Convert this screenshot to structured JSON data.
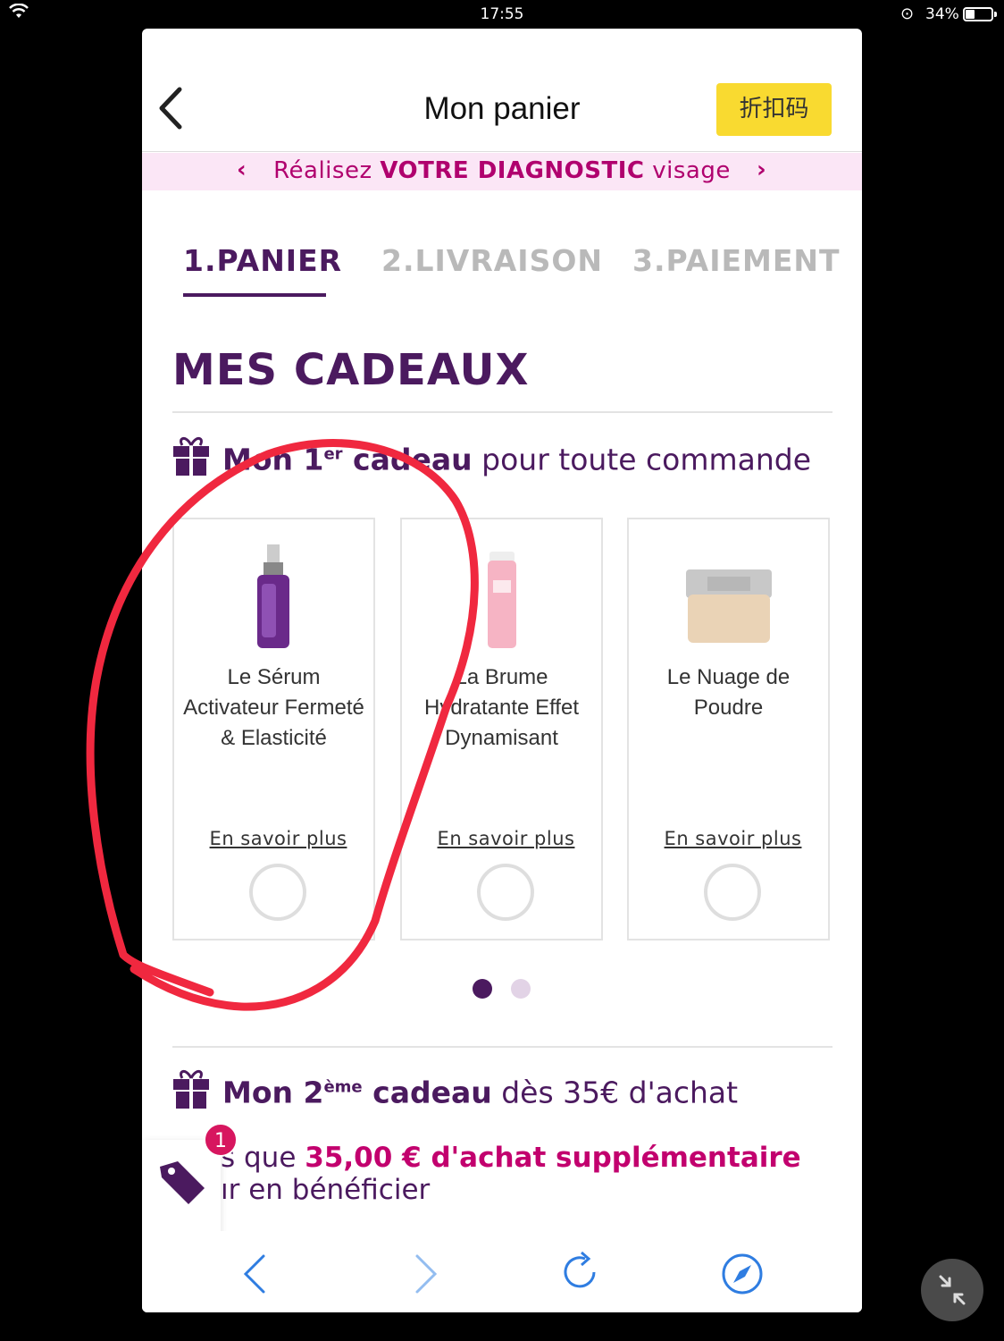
{
  "status_bar": {
    "time": "17:55",
    "battery": "34%",
    "battery_level": 0.34
  },
  "header": {
    "title": "Mon panier",
    "promo_button": "折扣码"
  },
  "diagnostic_banner": {
    "pre": "Réalisez ",
    "bold": "VOTRE DIAGNOSTIC",
    "post": " visage"
  },
  "steps": [
    {
      "label": "1.PANIER",
      "active": true
    },
    {
      "label": "2.LIVRAISON",
      "active": false
    },
    {
      "label": "3.PAIEMENT",
      "active": false
    }
  ],
  "section_title": "MES CADEAUX",
  "gift1": {
    "prefix": "Mon 1",
    "sup": "er",
    "bold_tail": " cadeau",
    "rest": " pour toute commande"
  },
  "products": [
    {
      "name": "Le Sérum Activateur Fermeté & Elasticité",
      "more": "En savoir plus",
      "selected": false
    },
    {
      "name": "La Brume Hydratante Effet Dynamisant",
      "more": "En savoir plus",
      "selected": false
    },
    {
      "name": "Le Nuage de Poudre",
      "more": "En savoir plus",
      "selected": false
    }
  ],
  "pagination": {
    "pages": 2,
    "current": 1
  },
  "gift2": {
    "prefix": "Mon 2",
    "sup": "ème",
    "bold_tail": " cadeau",
    "rest": " dès 35€ d'achat"
  },
  "threshold": {
    "line1_pre": "s que ",
    "line1_bold": "35,00 € d'achat supplémentaire",
    "line2": "ır en bénéficier"
  },
  "badge_count": "1",
  "colors": {
    "brand_purple": "#4b1a5f",
    "accent_pink": "#c2006e",
    "promo_yellow": "#f9da30",
    "annotation_red": "#f0283f",
    "browser_blue": "#2f7de1"
  }
}
